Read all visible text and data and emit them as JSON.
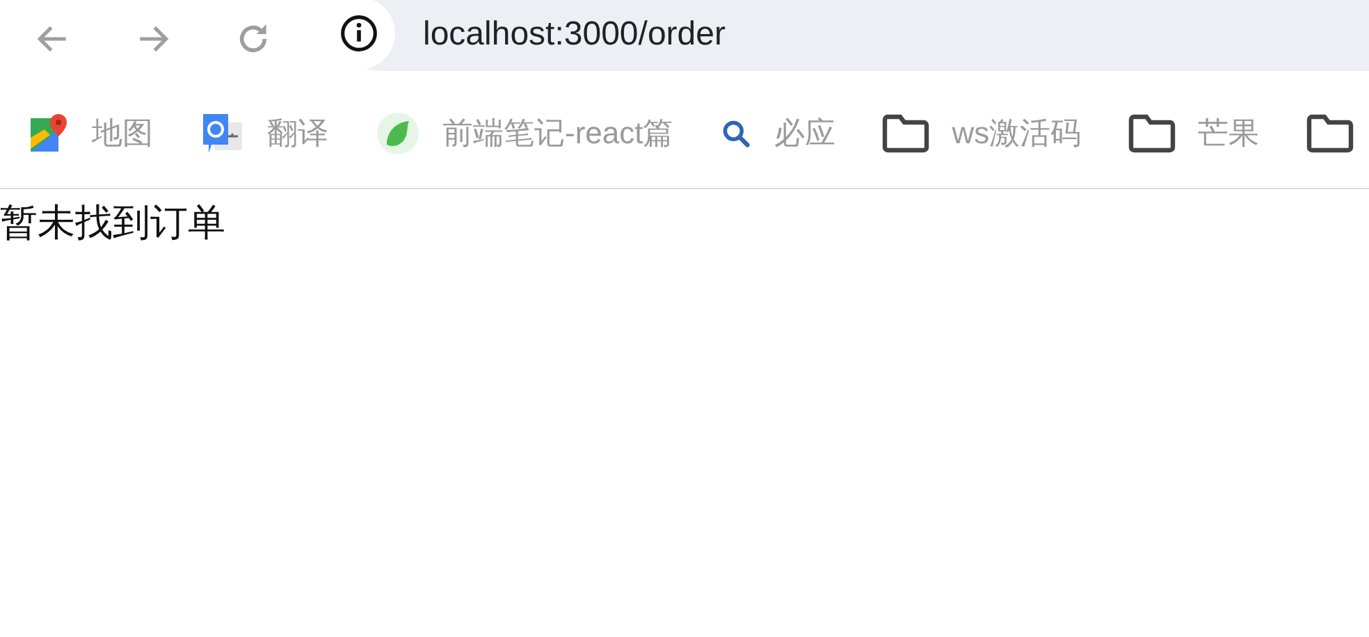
{
  "address_bar": {
    "url": "localhost:3000/order"
  },
  "bookmarks": [
    {
      "kind": "maps",
      "label": "地图"
    },
    {
      "kind": "translate",
      "label": "翻译"
    },
    {
      "kind": "leaf",
      "label": "前端笔记-react篇"
    },
    {
      "kind": "search",
      "label": "必应"
    },
    {
      "kind": "folder",
      "label": "ws激活码"
    },
    {
      "kind": "folder",
      "label": "芒果"
    },
    {
      "kind": "folder"
    }
  ],
  "page": {
    "message": "暂未找到订单"
  }
}
